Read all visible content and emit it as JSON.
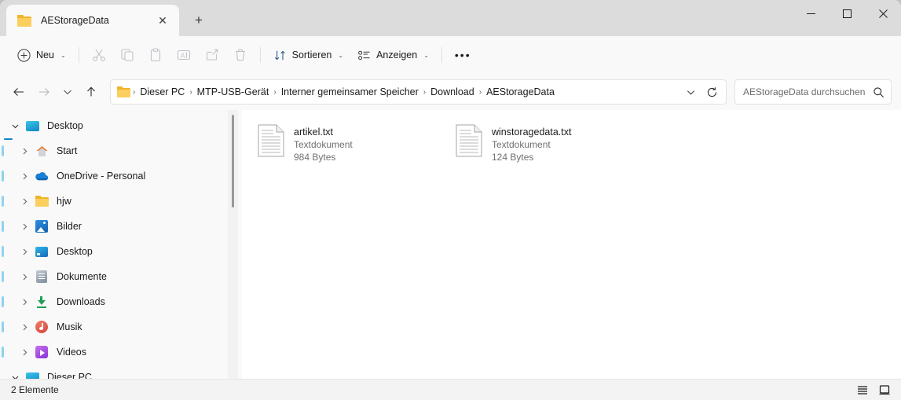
{
  "window": {
    "tab": {
      "title": "AEStorageData",
      "icon": "folder-icon",
      "close_label": "✕"
    },
    "new_tab_label": "+",
    "controls": {
      "minimize": "─",
      "maximize": "□",
      "close": "✕"
    }
  },
  "toolbar": {
    "new_label": "Neu",
    "new_chevron": "⌄",
    "cut_label": "Ausschneiden",
    "copy_label": "Kopieren",
    "paste_label": "Einfügen",
    "rename_label": "Umbenennen",
    "share_label": "Freigeben",
    "delete_label": "Löschen",
    "sort_label": "Sortieren",
    "sort_chevron": "⌄",
    "view_label": "Anzeigen",
    "view_chevron": "⌄",
    "more_label": "•••"
  },
  "address": {
    "back": "←",
    "forward": "→",
    "recent_chevron": "⌄",
    "up": "↑",
    "folder_icon": "folder-icon",
    "crumbs": [
      "Dieser PC",
      "MTP-USB-Gerät",
      "Interner gemeinsamer Speicher",
      "Download",
      "AEStorageData"
    ],
    "separator": "›",
    "dropdown_chevron": "⌄",
    "refresh": "↻"
  },
  "search": {
    "placeholder": "AEStorageData durchsuchen",
    "value": "",
    "icon": "search-icon"
  },
  "sidebar": {
    "items": [
      {
        "label": "Desktop",
        "icon": "monitor-icon",
        "expander": "⌄",
        "expanded": true,
        "indent": false
      },
      {
        "label": "Start",
        "icon": "home-icon",
        "expander": "›",
        "expanded": false,
        "indent": true
      },
      {
        "label": "OneDrive - Personal",
        "icon": "cloud-icon",
        "expander": "›",
        "expanded": false,
        "indent": true
      },
      {
        "label": "hjw",
        "icon": "folder-icon",
        "expander": "›",
        "expanded": false,
        "indent": true
      },
      {
        "label": "Bilder",
        "icon": "pictures-icon",
        "expander": "›",
        "expanded": false,
        "indent": true
      },
      {
        "label": "Desktop",
        "icon": "desktop-icon",
        "expander": "›",
        "expanded": false,
        "indent": true
      },
      {
        "label": "Dokumente",
        "icon": "documents-icon",
        "expander": "›",
        "expanded": false,
        "indent": true
      },
      {
        "label": "Downloads",
        "icon": "downloads-icon",
        "expander": "›",
        "expanded": false,
        "indent": true
      },
      {
        "label": "Musik",
        "icon": "music-icon",
        "expander": "›",
        "expanded": false,
        "indent": true
      },
      {
        "label": "Videos",
        "icon": "videos-icon",
        "expander": "›",
        "expanded": false,
        "indent": true
      },
      {
        "label": "Dieser PC",
        "icon": "monitor-icon",
        "expander": "⌄",
        "expanded": true,
        "indent": false
      }
    ]
  },
  "files": [
    {
      "name": "artikel.txt",
      "type": "Textdokument",
      "size": "984 Bytes",
      "icon": "text-document-icon"
    },
    {
      "name": "winstoragedata.txt",
      "type": "Textdokument",
      "size": "124 Bytes",
      "icon": "text-document-icon"
    }
  ],
  "status": {
    "item_count": "2 Elemente",
    "details_view": "details-view-icon",
    "large_icons_view": "large-icons-view-icon"
  },
  "colors": {
    "accent": "#0078d4",
    "folder": "#f0b429",
    "window_bg": "#f9f9f9",
    "titlebar_bg": "#dcdcdc",
    "pane_bg": "#ffffff"
  }
}
